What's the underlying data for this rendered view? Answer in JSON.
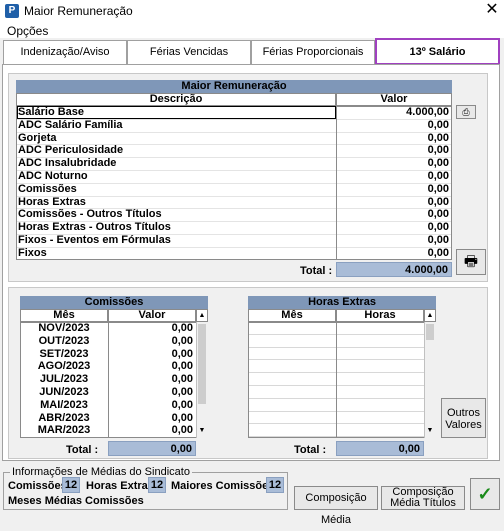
{
  "window": {
    "title": "Maior Remuneração",
    "close": "✕"
  },
  "menu": {
    "options": "Opções"
  },
  "tabs": [
    {
      "label": "Indenização/Aviso Prévio"
    },
    {
      "label": "Férias Vencidas"
    },
    {
      "label": "Férias Proporcionais"
    },
    {
      "label": "13º Salário"
    }
  ],
  "main_grid": {
    "title": "Maior Remuneração",
    "col_desc": "Descrição",
    "col_value": "Valor",
    "rows": [
      {
        "desc": "Salário Base",
        "value": "4.000,00"
      },
      {
        "desc": "ADC Salário Família",
        "value": "0,00"
      },
      {
        "desc": "Gorjeta",
        "value": "0,00"
      },
      {
        "desc": "ADC Periculosidade",
        "value": "0,00"
      },
      {
        "desc": "ADC Insalubridade",
        "value": "0,00"
      },
      {
        "desc": "ADC Noturno",
        "value": "0,00"
      },
      {
        "desc": "Comissões",
        "value": "0,00"
      },
      {
        "desc": "Horas Extras",
        "value": "0,00"
      },
      {
        "desc": "Comissões - Outros Títulos",
        "value": "0,00"
      },
      {
        "desc": "Horas Extras - Outros Títulos",
        "value": "0,00"
      },
      {
        "desc": "Fixos - Eventos em Fórmulas",
        "value": "0,00"
      },
      {
        "desc": "Fixos",
        "value": "0,00"
      }
    ],
    "total_label": "Total :",
    "total_value": "4.000,00"
  },
  "comissoes": {
    "title": "Comissões",
    "col_month": "Mês",
    "col_value": "Valor",
    "rows": [
      {
        "month": "NOV/2023",
        "value": "0,00"
      },
      {
        "month": "OUT/2023",
        "value": "0,00"
      },
      {
        "month": "SET/2023",
        "value": "0,00"
      },
      {
        "month": "AGO/2023",
        "value": "0,00"
      },
      {
        "month": "JUL/2023",
        "value": "0,00"
      },
      {
        "month": "JUN/2023",
        "value": "0,00"
      },
      {
        "month": "MAI/2023",
        "value": "0,00"
      },
      {
        "month": "ABR/2023",
        "value": "0,00"
      },
      {
        "month": "MAR/2023",
        "value": "0,00"
      }
    ],
    "total_label": "Total :",
    "total_value": "0,00"
  },
  "horas_extras": {
    "title": "Horas Extras",
    "col_month": "Mês",
    "col_hours": "Horas",
    "total_label": "Total :",
    "total_value": "0,00"
  },
  "buttons": {
    "outros_valores": "Outros Valores",
    "composicao_media": "Composição Média",
    "composicao_media_titulos": "Composição Média Títulos",
    "ok": "✓",
    "calc": "⎙",
    "print": "🖶"
  },
  "footer": {
    "group_title": "Informações de Médias do Sindicato",
    "comissoes_label": "Comissões",
    "comissoes_value": "12",
    "horas_extras_label": "Horas Extras",
    "horas_extras_value": "12",
    "maiores_label": "Maiores Comissões",
    "maiores_value": "12",
    "meses_label": "Meses Médias Comissões"
  }
}
